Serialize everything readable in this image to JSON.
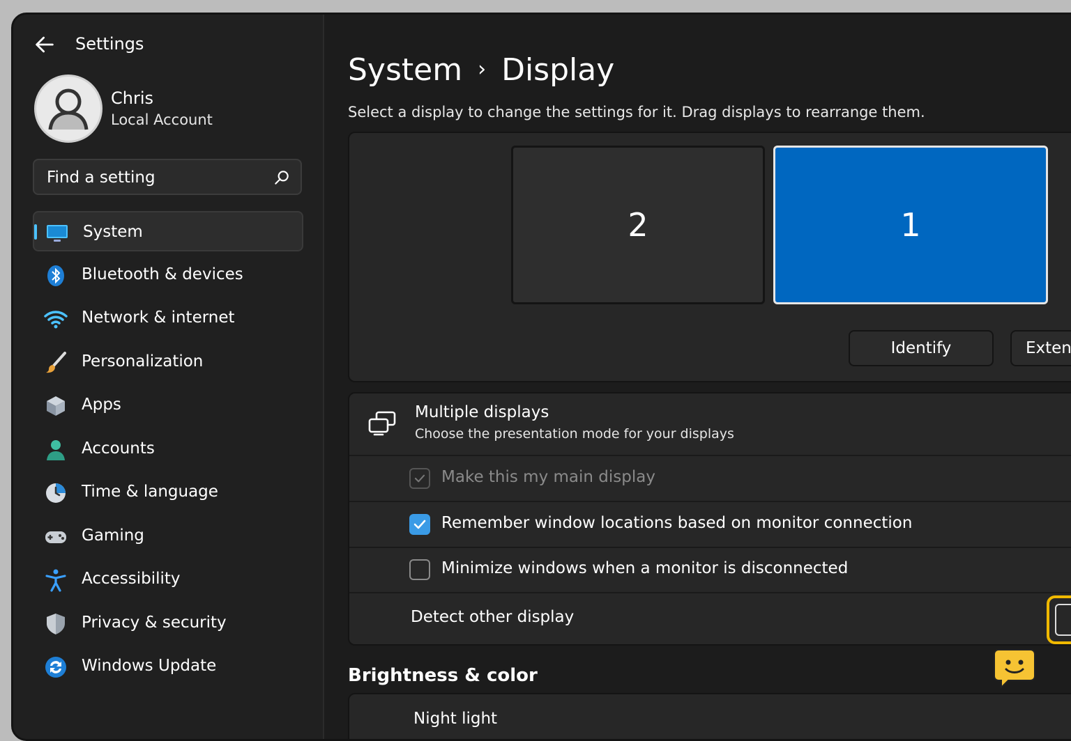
{
  "window": {
    "title": "Settings"
  },
  "user": {
    "name": "Chris",
    "account_type": "Local Account"
  },
  "search": {
    "placeholder": "Find a setting"
  },
  "nav": [
    {
      "label": "System",
      "icon": "monitor-icon",
      "active": true
    },
    {
      "label": "Bluetooth & devices",
      "icon": "bluetooth-icon"
    },
    {
      "label": "Network & internet",
      "icon": "wifi-icon"
    },
    {
      "label": "Personalization",
      "icon": "brush-icon"
    },
    {
      "label": "Apps",
      "icon": "apps-icon"
    },
    {
      "label": "Accounts",
      "icon": "person-icon"
    },
    {
      "label": "Time & language",
      "icon": "clock-icon"
    },
    {
      "label": "Gaming",
      "icon": "gamepad-icon"
    },
    {
      "label": "Accessibility",
      "icon": "accessibility-icon"
    },
    {
      "label": "Privacy & security",
      "icon": "shield-icon"
    },
    {
      "label": "Windows Update",
      "icon": "update-icon"
    }
  ],
  "breadcrumb": {
    "parent": "System",
    "separator": "›",
    "current": "Display"
  },
  "main": {
    "description": "Select a display to change the settings for it. Drag displays to rearrange them.",
    "monitors": [
      {
        "label": "2",
        "selected": false
      },
      {
        "label": "1",
        "selected": true
      }
    ],
    "identify_label": "Identify",
    "extend_label": "Extend"
  },
  "multiple_displays": {
    "title": "Multiple displays",
    "subtitle": "Choose the presentation mode for your displays",
    "options": [
      {
        "label": "Make this my main display",
        "checked": true,
        "disabled": true
      },
      {
        "label": "Remember window locations based on monitor connection",
        "checked": true,
        "disabled": false
      },
      {
        "label": "Minimize windows when a monitor is disconnected",
        "checked": false,
        "disabled": false
      }
    ],
    "detect_label": "Detect other display"
  },
  "brightness": {
    "section_title": "Brightness & color",
    "night_light_label": "Night light"
  },
  "colors": {
    "accent": "#4cc2ff",
    "monitor_selected": "#0067c0",
    "checkbox": "#3a9be6",
    "focus_ring": "#f0b900"
  }
}
